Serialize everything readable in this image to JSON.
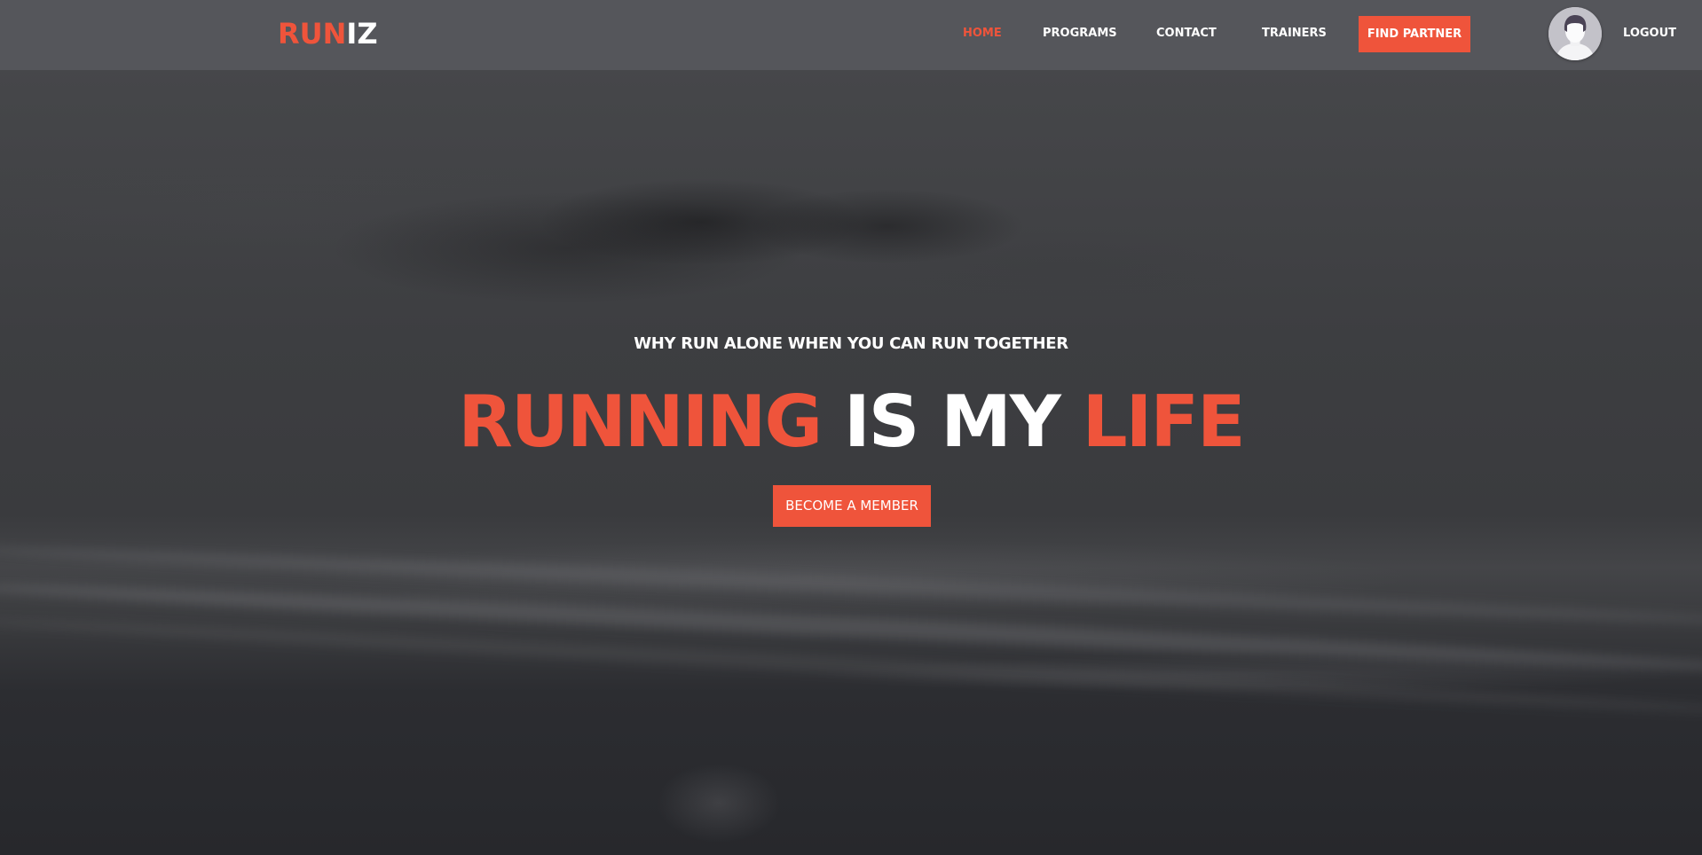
{
  "brand": {
    "logo_part1": "RUN",
    "logo_part2": "IZ",
    "accent_color": "#ef543b"
  },
  "nav": {
    "items": [
      {
        "label": "HOME",
        "active": true
      },
      {
        "label": "PROGRAMS",
        "active": false
      },
      {
        "label": "CONTACT",
        "active": false
      },
      {
        "label": "TRAINERS",
        "active": false
      }
    ],
    "cta_label": "FIND PARTNER",
    "logout_label": "LOGOUT",
    "avatar_icon": "user-avatar-icon"
  },
  "hero": {
    "tagline": "WHY RUN ALONE WHEN YOU CAN RUN TOGETHER",
    "headline": {
      "word1": "RUNNING",
      "word2": "IS",
      "word3": "MY",
      "word4": "LIFE"
    },
    "cta_label": "BECOME A MEMBER"
  }
}
